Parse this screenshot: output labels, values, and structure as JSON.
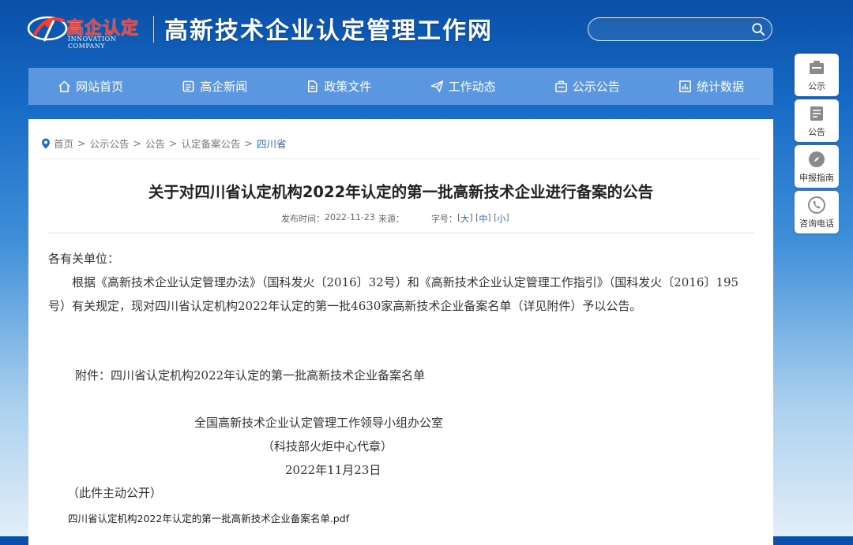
{
  "header": {
    "logo_cn": "高企认定",
    "logo_en": "INNOVATION COMPANY",
    "site_title": "高新技术企业认定管理工作网",
    "search_placeholder": ""
  },
  "nav": {
    "items": [
      {
        "label": "网站首页",
        "icon": "home-icon"
      },
      {
        "label": "高企新闻",
        "icon": "news-icon"
      },
      {
        "label": "政策文件",
        "icon": "document-icon"
      },
      {
        "label": "工作动态",
        "icon": "send-icon"
      },
      {
        "label": "公示公告",
        "icon": "notice-icon"
      },
      {
        "label": "统计数据",
        "icon": "chart-icon"
      }
    ]
  },
  "side_tools": [
    {
      "label": "公示",
      "icon": "publicity-icon"
    },
    {
      "label": "公告",
      "icon": "announcement-icon"
    },
    {
      "label": "申报指南",
      "icon": "compass-icon"
    },
    {
      "label": "咨询电话",
      "icon": "phone-icon"
    }
  ],
  "breadcrumb": {
    "items": [
      "首页",
      "公示公告",
      "公告",
      "认定备案公告",
      "四川省"
    ],
    "separator": ">"
  },
  "article": {
    "title": "关于对四川省认定机构2022年认定的第一批高新技术企业进行备案的公告",
    "publish_label": "发布时间：",
    "publish_date": "2022-11-23",
    "source_label": "来源：",
    "fontsize_label": "字号：",
    "fontsize_options": [
      "大",
      "中",
      "小"
    ],
    "greeting": "各有关单位：",
    "paragraph": "根据《高新技术企业认定管理办法》（国科发火〔2016〕32号）和《高新技术企业认定管理工作指引》（国科发火〔2016〕195号）有关规定，现对四川省认定机构2022年认定的第一批4630家高新技术企业备案名单（详见附件）予以公告。",
    "attachment_text": "附件：四川省认定机构2022年认定的第一批高新技术企业备案名单",
    "signature_org": "全国高新技术企业认定管理工作领导小组办公室",
    "signature_agent": "（科技部火炬中心代章）",
    "signature_date": "2022年11月23日",
    "public_note": "（此件主动公开）",
    "attachment_file": "四川省认定机构2022年认定的第一批高新技术企业备案名单.pdf"
  },
  "colors": {
    "nav_bg": "#5a97e0",
    "link": "#2b67c9",
    "logo_red": "#ff3b2a"
  }
}
